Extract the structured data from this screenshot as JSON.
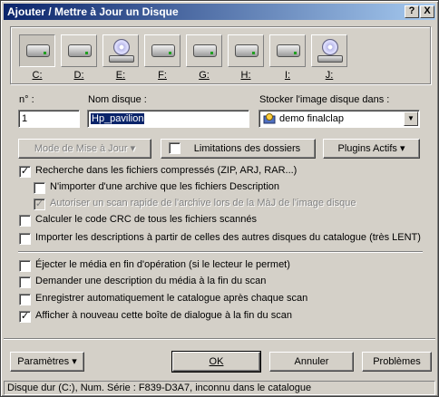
{
  "window": {
    "title": "Ajouter / Mettre à Jour un Disque",
    "help_btn": "?",
    "close_btn": "X"
  },
  "drives": [
    {
      "label": "C:",
      "kind": "hdd",
      "selected": true
    },
    {
      "label": "D:",
      "kind": "hdd"
    },
    {
      "label": "E:",
      "kind": "cd"
    },
    {
      "label": "F:",
      "kind": "hdd"
    },
    {
      "label": "G:",
      "kind": "hdd"
    },
    {
      "label": "H:",
      "kind": "hdd"
    },
    {
      "label": "I:",
      "kind": "hdd"
    },
    {
      "label": "J:",
      "kind": "cd"
    }
  ],
  "form": {
    "num_label": "n° :",
    "num_value": "1",
    "name_label": "Nom disque :",
    "name_value": "Hp_pavilion",
    "store_label": "Stocker l'image disque dans :",
    "store_value": "demo finalclap"
  },
  "buttons": {
    "update_mode": "Mode de Mise à Jour",
    "folder_limits": "Limitations des dossiers",
    "active_plugins": "Plugins Actifs",
    "parameters": "Paramètres",
    "ok": "OK",
    "cancel": "Annuler",
    "problems": "Problèmes"
  },
  "options": {
    "compressed": {
      "label": "Recherche dans les fichiers compressés (ZIP, ARJ, RAR...)",
      "checked": true
    },
    "only_description": {
      "label": "N'importer d'une archive que les fichiers Description",
      "checked": false
    },
    "fast_scan": {
      "label": "Autoriser un scan rapide de l'archive lors de la MàJ de l'image disque",
      "checked": true,
      "disabled": true
    },
    "crc": {
      "label": "Calculer le code CRC de tous les fichiers scannés",
      "checked": false
    },
    "import_desc": {
      "label": "Importer les descriptions à partir de celles des autres disques du catalogue (très LENT)",
      "checked": false
    },
    "eject": {
      "label": "Éjecter le média en fin d'opération (si le lecteur le permet)",
      "checked": false
    },
    "ask_desc": {
      "label": "Demander une description du média à la fin du scan",
      "checked": false
    },
    "save_auto": {
      "label": "Enregistrer automatiquement le catalogue après chaque scan",
      "checked": false
    },
    "show_again": {
      "label": "Afficher à nouveau cette boîte de dialogue à la fin du scan",
      "checked": true
    }
  },
  "status": "Disque dur (C:), Num. Série : F839-D3A7, inconnu dans le catalogue"
}
